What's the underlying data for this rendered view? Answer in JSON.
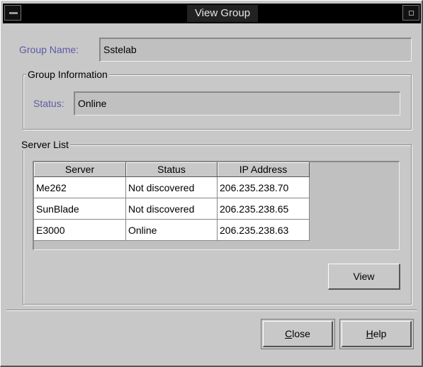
{
  "window": {
    "title": "View Group"
  },
  "group_name": {
    "label": "Group Name:",
    "value": "Sstelab"
  },
  "group_information": {
    "title": "Group Information",
    "status_label": "Status:",
    "status_value": "Online"
  },
  "server_list": {
    "title": "Server List",
    "columns": [
      "Server",
      "Status",
      "IP Address"
    ],
    "rows": [
      [
        "Me262",
        "Not discovered",
        "206.235.238.70"
      ],
      [
        "SunBlade",
        "Not discovered",
        "206.235.238.65"
      ],
      [
        "E3000",
        "Online",
        "206.235.238.63"
      ]
    ],
    "view_label": "View"
  },
  "buttons": {
    "close_mnemonic": "C",
    "close_rest": "lose",
    "help_mnemonic": "H",
    "help_rest": "elp"
  }
}
